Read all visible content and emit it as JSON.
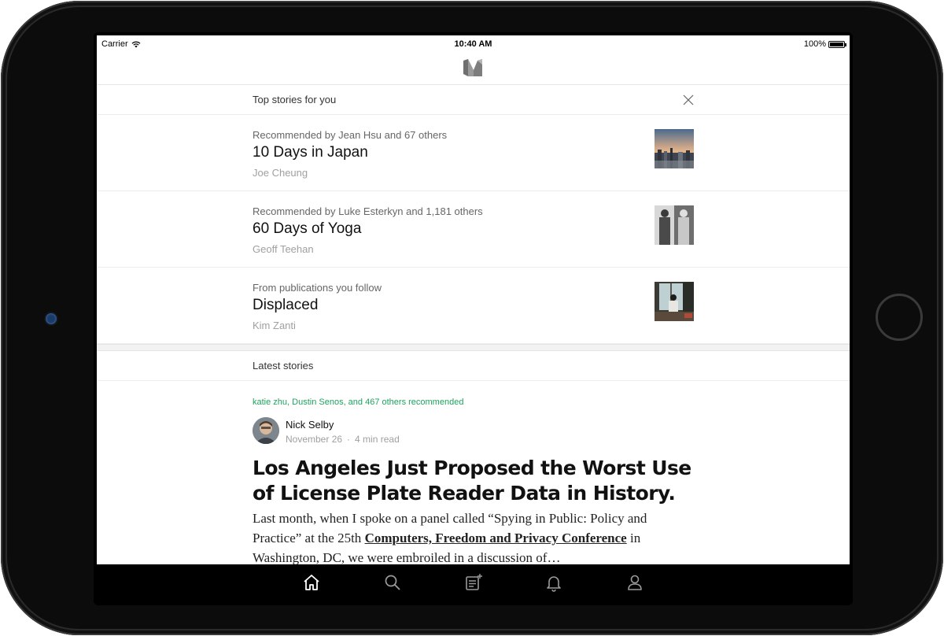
{
  "status_bar": {
    "carrier": "Carrier",
    "time": "10:40 AM",
    "battery": "100%"
  },
  "top_stories": {
    "header": "Top stories for you",
    "items": [
      {
        "reason": "Recommended by Jean Hsu and 67 others",
        "title": "10 Days in Japan",
        "author": "Joe Cheung"
      },
      {
        "reason": "Recommended by Luke Esterkyn and 1,181 others",
        "title": "60 Days of Yoga",
        "author": "Geoff Teehan"
      },
      {
        "reason": "From publications you follow",
        "title": "Displaced",
        "author": "Kim Zanti"
      }
    ]
  },
  "latest": {
    "header": "Latest stories",
    "recommended_by": "katie zhu, Dustin Senos, and 467 others recommended",
    "author": "Nick Selby",
    "date": "November 26",
    "separator": "·",
    "read_time": "4 min read",
    "title": "Los Angeles Just Proposed the Worst Use of License Plate Reader Data in History.",
    "excerpt_start": "Last month, when I spoke on a panel called “Spying in Public: Policy and Practice” at the 25th ",
    "excerpt_link": "Computers, Freedom and Privacy Conference",
    "excerpt_end": " in Washington, DC, we were embroiled in a discussion of…"
  },
  "tabbar": {
    "tabs": [
      {
        "icon": "home-icon",
        "active": true
      },
      {
        "icon": "search-icon",
        "active": false
      },
      {
        "icon": "compose-icon",
        "active": false
      },
      {
        "icon": "bell-icon",
        "active": false
      },
      {
        "icon": "profile-icon",
        "active": false
      }
    ]
  },
  "colors": {
    "accent_green": "#1fa35c",
    "tabbar_bg": "#000000",
    "muted_text": "#a0a0a0"
  }
}
